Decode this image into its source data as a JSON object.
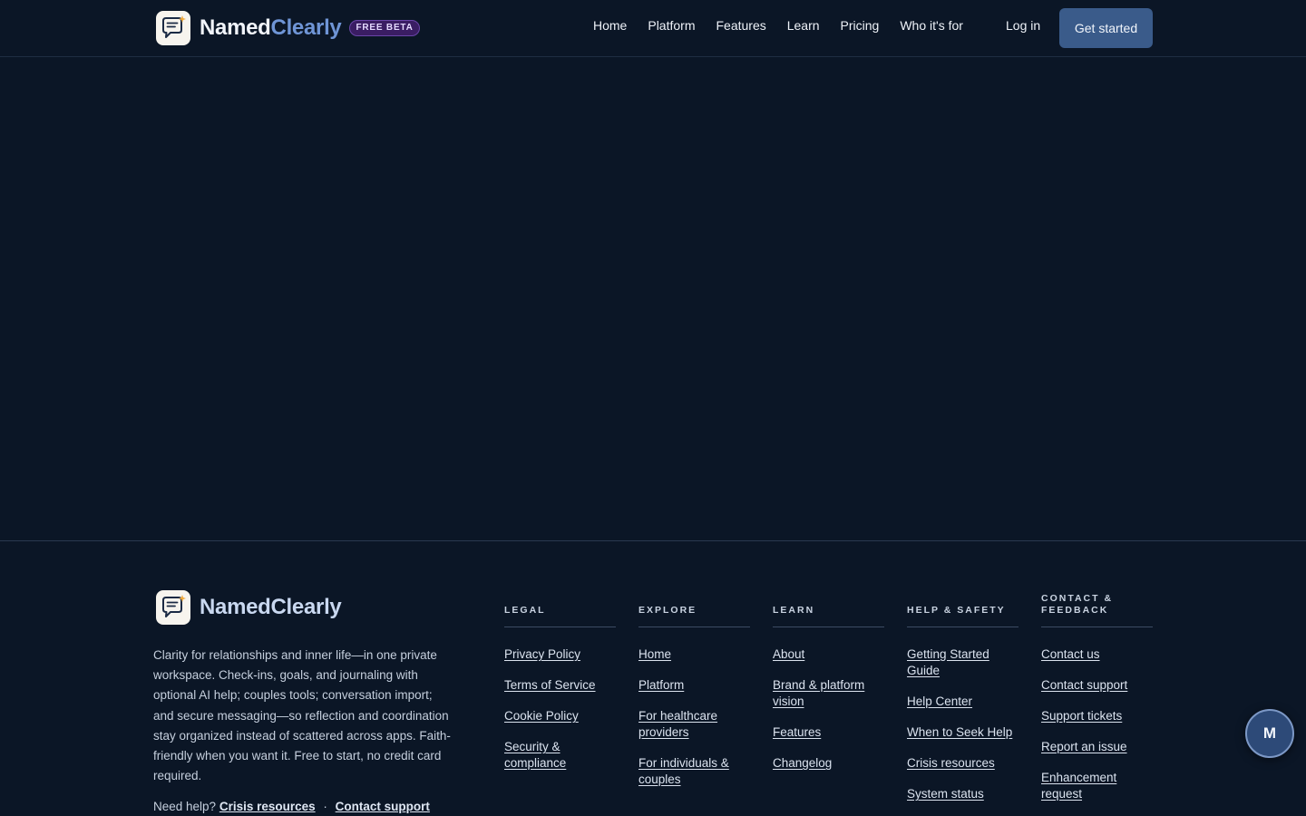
{
  "header": {
    "brand_part1": "Named",
    "brand_part2": "Clearly",
    "badge": "FREE BETA",
    "nav": [
      "Home",
      "Platform",
      "Features",
      "Learn",
      "Pricing",
      "Who it's for"
    ],
    "login": "Log in",
    "cta": "Get started"
  },
  "footer": {
    "brand": "NamedClearly",
    "description": "Clarity for relationships and inner life—in one private workspace. Check-ins, goals, and journaling with optional AI help; couples tools; conversation import; and secure messaging—so reflection and coordination stay organized instead of scattered across apps. Faith-friendly when you want it. Free to start, no credit card required.",
    "help_prefix": "Need help?",
    "help_link1": "Crisis resources",
    "help_sep": "·",
    "help_link2": "Contact support",
    "columns": [
      {
        "title": "LEGAL",
        "links": [
          "Privacy Policy",
          "Terms of Service",
          "Cookie Policy",
          "Security & compliance"
        ]
      },
      {
        "title": "EXPLORE",
        "links": [
          "Home",
          "Platform",
          "For healthcare providers",
          "For individuals & couples"
        ]
      },
      {
        "title": "LEARN",
        "links": [
          "About",
          "Brand & platform vision",
          "Features",
          "Changelog"
        ]
      },
      {
        "title": "HELP & SAFETY",
        "links": [
          "Getting Started Guide",
          "Help Center",
          "When to Seek Help",
          "Crisis resources",
          "System status"
        ]
      },
      {
        "title": "CONTACT & FEEDBACK",
        "links": [
          "Contact us",
          "Contact support",
          "Support tickets",
          "Report an issue",
          "Enhancement request"
        ]
      }
    ]
  },
  "avatar": "M",
  "colors": {
    "background": "#0b1626",
    "accent": "#3a5b8a",
    "brand_accent": "#6f95d6",
    "badge": "#3a1d63"
  },
  "icons": {
    "logo": "chat-bubble-sparkle-icon"
  }
}
